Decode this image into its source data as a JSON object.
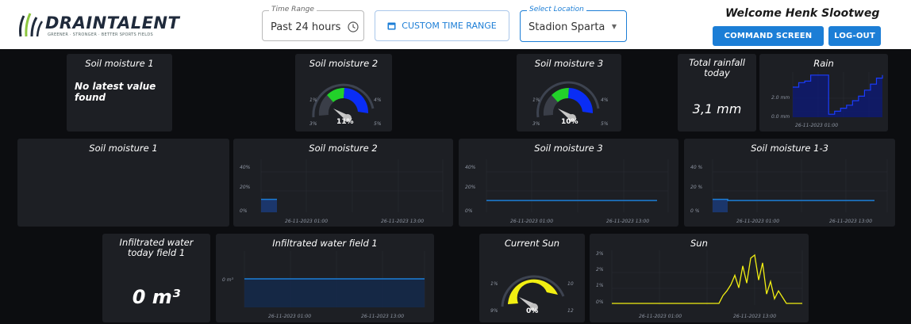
{
  "header": {
    "logo_text": "DRAINTALENT",
    "logo_tagline": "GREENER · STRONGER · BETTER SPORTS FIELDS",
    "time_range_legend": "Time Range",
    "time_range_value": "Past 24 hours",
    "custom_button": "CUSTOM TIME RANGE",
    "location_legend": "Select Location",
    "location_value": "Stadion Sparta",
    "welcome": "Welcome Henk Slootweg",
    "command_button": "COMMAND SCREEN",
    "logout_button": "LOG-OUT"
  },
  "row1": {
    "sm1_title": "Soil moisture 1",
    "sm1_msg": "No latest value found",
    "sm2_title": "Soil moisture 2",
    "sm2_gauge": {
      "value": 11,
      "label": "11%",
      "ticks": [
        "1%",
        "3%",
        "4%",
        "5%"
      ]
    },
    "sm3_title": "Soil moisture 3",
    "sm3_gauge": {
      "value": 10,
      "label": "10%",
      "ticks": [
        "1%",
        "3%",
        "4%",
        "5%"
      ]
    },
    "rain_total_title": "Total rainfall today",
    "rain_total_value": "3,1 mm",
    "rain_title": "Rain",
    "rain_ticks": [
      "2.0 mm",
      "0.0 mm"
    ],
    "rain_date": "26-11-2023 01:00"
  },
  "row2": {
    "sm1_title": "Soil moisture 1",
    "sm2_title": "Soil moisture 2",
    "sm3_title": "Soil moisture 3",
    "sm13_title": "Soil moisture 1-3",
    "pct_ticks": [
      "40%",
      "20%",
      "0%"
    ],
    "pct_ticks_sp": [
      "40 %",
      "20 %",
      "0 %"
    ],
    "date1": "26-11-2023 01:00",
    "date2": "26-11-2023 13:00"
  },
  "row3": {
    "infil_today_title": "Infiltrated water today field 1",
    "infil_today_value": "0 m³",
    "infil_title": "Infiltrated water field 1",
    "infil_tick": "0 m³",
    "sun_current_title": "Current Sun",
    "sun_gauge": {
      "value": 0,
      "label": "0%",
      "ticks": [
        "1%",
        "9%",
        "10",
        "12"
      ]
    },
    "sun_title": "Sun",
    "sun_ticks": [
      "3%",
      "2%",
      "1%",
      "0%"
    ],
    "date1": "26-11-2023 01:00",
    "date2": "26-11-2023 13:00"
  },
  "colors": {
    "panel": "#1d1f24",
    "blue_line": "#1c7ed6",
    "gauge_blue": "#0a2df5",
    "gauge_green": "#22d12a",
    "sun_yellow": "#f2ef12",
    "button_blue": "#1c7ed6"
  },
  "icons": {
    "calendar": "calendar-icon",
    "clock": "clock-icon",
    "dropdown": "chevron-down-icon"
  },
  "chart_data": [
    {
      "type": "area",
      "title": "Rain",
      "y_ticks": [
        "2.0 mm",
        "0.0 mm"
      ],
      "x_ticks": [
        "26-11-2023 01:00"
      ],
      "ylim": [
        0,
        3
      ],
      "values": [
        2.0,
        2.3,
        2.4,
        2.8,
        2.8,
        2.8,
        0.2,
        0.4,
        0.6,
        0.8,
        1.1,
        1.4,
        1.8,
        2.2,
        2.6,
        2.8
      ]
    },
    {
      "type": "bar",
      "title": "Soil moisture 2",
      "y_ticks": [
        "40%",
        "20%",
        "0%"
      ],
      "x_ticks": [
        "26-11-2023 01:00",
        "26-11-2023 13:00"
      ],
      "ylim": [
        0,
        45
      ],
      "values": [
        11
      ]
    },
    {
      "type": "line",
      "title": "Soil moisture 3",
      "y_ticks": [
        "40%",
        "20%",
        "0%"
      ],
      "x_ticks": [
        "26-11-2023 01:00",
        "26-11-2023 13:00"
      ],
      "ylim": [
        0,
        45
      ],
      "values": [
        10,
        10
      ]
    },
    {
      "type": "line",
      "title": "Soil moisture 1-3",
      "y_ticks": [
        "40 %",
        "20 %",
        "0 %"
      ],
      "x_ticks": [
        "26-11-2023 01:00",
        "26-11-2023 13:00"
      ],
      "ylim": [
        0,
        45
      ],
      "values": [
        11,
        10
      ]
    },
    {
      "type": "area",
      "title": "Infiltrated water field 1",
      "y_ticks": [
        "0 m³"
      ],
      "x_ticks": [
        "26-11-2023 01:00",
        "26-11-2023 13:00"
      ],
      "values": [
        0,
        0
      ]
    },
    {
      "type": "line",
      "title": "Sun",
      "y_ticks": [
        "3%",
        "2%",
        "1%",
        "0%"
      ],
      "x_ticks": [
        "26-11-2023 01:00",
        "26-11-2023 13:00"
      ],
      "ylim": [
        0,
        3.3
      ],
      "values": [
        0,
        0,
        0,
        0,
        0,
        0,
        0,
        0,
        0,
        0,
        0,
        0,
        0,
        0,
        0,
        0,
        0,
        0,
        0,
        0,
        0,
        0,
        0,
        0,
        0,
        0,
        0,
        0,
        0.5,
        0.8,
        1.2,
        1.8,
        1.0,
        2.4,
        1.3,
        2.9,
        3.1,
        1.5,
        2.6,
        0.6,
        1.4,
        0.3,
        0.8,
        0.4,
        0,
        0,
        0,
        0,
        0
      ]
    }
  ]
}
